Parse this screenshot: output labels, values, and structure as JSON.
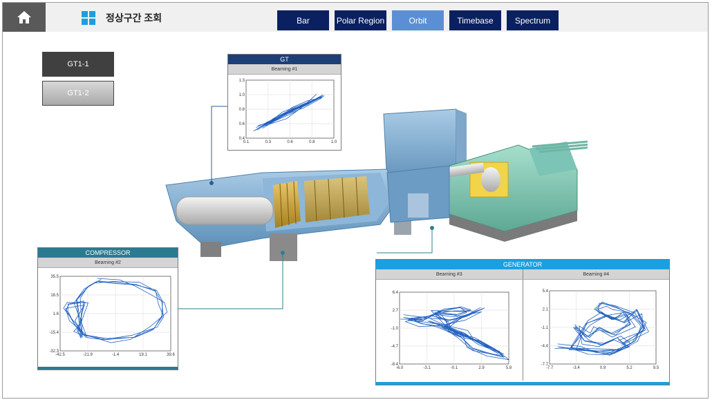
{
  "header": {
    "title": "정상구간 조회",
    "tabs": [
      {
        "label": "Bar",
        "active": false
      },
      {
        "label": "Polar Region",
        "active": false
      },
      {
        "label": "Orbit",
        "active": true
      },
      {
        "label": "Timebase",
        "active": false
      },
      {
        "label": "Spectrum",
        "active": false
      }
    ]
  },
  "units": [
    {
      "label": "GT1-1",
      "selected": false
    },
    {
      "label": "GT1-2",
      "selected": true
    }
  ],
  "panels": {
    "gt": {
      "title": "GT",
      "subtitle": "Bearning #1"
    },
    "compressor": {
      "title": "COMPRESSOR",
      "subtitle": "Bearning #2"
    },
    "generator": {
      "title": "GENERATOR",
      "sub1": "Bearning #3",
      "sub2": "Bearning #4"
    }
  },
  "chart_data": [
    {
      "type": "line",
      "name": "Bearning #1",
      "xlim": [
        0.1,
        1.0
      ],
      "ylim": [
        0.4,
        1.3
      ],
      "xticks": [
        "0.1",
        "0.3",
        "0.6",
        "0.8",
        "1.0"
      ],
      "yticks": [
        "1.3",
        "1.0",
        "0.8",
        "0.6",
        "0.4"
      ],
      "trace": [
        [
          0.2,
          0.53
        ],
        [
          0.42,
          0.72
        ],
        [
          0.62,
          0.86
        ],
        [
          0.78,
          0.98
        ],
        [
          0.88,
          1.06
        ],
        [
          0.72,
          0.93
        ],
        [
          0.5,
          0.78
        ],
        [
          0.32,
          0.62
        ],
        [
          0.48,
          0.74
        ],
        [
          0.68,
          0.9
        ],
        [
          0.86,
          1.04
        ],
        [
          0.75,
          0.96
        ],
        [
          0.58,
          0.85
        ],
        [
          0.4,
          0.7
        ],
        [
          0.26,
          0.58
        ]
      ]
    },
    {
      "type": "line",
      "name": "Bearning #2",
      "xlim": [
        -42.5,
        39.6
      ],
      "ylim": [
        -32.3,
        35.5
      ],
      "xticks": [
        "-42.5",
        "-21.9",
        "-1.4",
        "19.1",
        "39.6"
      ],
      "yticks": [
        "35.5",
        "18.5",
        "1.6",
        "-15.4",
        "-32.3"
      ],
      "trace": [
        [
          -15,
          31
        ],
        [
          -2,
          30
        ],
        [
          14,
          28
        ],
        [
          28,
          22
        ],
        [
          33,
          12
        ],
        [
          34,
          0
        ],
        [
          27,
          -12
        ],
        [
          12,
          -20
        ],
        [
          -8,
          -22
        ],
        [
          -25,
          -18
        ],
        [
          -32,
          -8
        ],
        [
          -38,
          5
        ],
        [
          -36,
          10
        ],
        [
          -24,
          12
        ],
        [
          -28,
          -6
        ],
        [
          -30,
          -14
        ],
        [
          -26,
          -20
        ],
        [
          -30,
          14
        ],
        [
          -22,
          26
        ],
        [
          -15,
          31
        ]
      ]
    },
    {
      "type": "line",
      "name": "Bearning #3",
      "xlim": [
        -6.0,
        5.8
      ],
      "ylim": [
        -8.4,
        6.4
      ],
      "xticks": [
        "-6.0",
        "-3.1",
        "-0.1",
        "2.9",
        "5.8"
      ],
      "yticks": [
        "6.4",
        "2.7",
        "-1.0",
        "-4.7",
        "-8.4"
      ],
      "trace": [
        [
          -5.6,
          1.2
        ],
        [
          -3.5,
          0.6
        ],
        [
          -1.5,
          2.5
        ],
        [
          0.5,
          3.2
        ],
        [
          1.6,
          2.6
        ],
        [
          0.2,
          1.8
        ],
        [
          -2.2,
          2.2
        ],
        [
          -0.9,
          0.3
        ],
        [
          -0.4,
          -1.5
        ],
        [
          0.8,
          -2.6
        ],
        [
          2.6,
          -3.6
        ],
        [
          4.4,
          -5.6
        ],
        [
          5.3,
          -7.0
        ],
        [
          3.5,
          -6.2
        ],
        [
          1.8,
          -5.2
        ],
        [
          0.6,
          -2.8
        ],
        [
          -1.8,
          -0.6
        ],
        [
          -3.6,
          -0.1
        ],
        [
          -5.0,
          0.8
        ],
        [
          -2.5,
          1.5
        ],
        [
          -0.6,
          0.7
        ],
        [
          1.2,
          1.5
        ],
        [
          3.0,
          3.0
        ],
        [
          0.6,
          1.0
        ],
        [
          -1.2,
          -0.8
        ],
        [
          0.2,
          -1.9
        ],
        [
          1.6,
          -3.0
        ],
        [
          3.3,
          -4.7
        ],
        [
          4.9,
          -6.0
        ],
        [
          2.5,
          -4.0
        ],
        [
          1.0,
          -2.0
        ],
        [
          -2.8,
          0.5
        ]
      ]
    },
    {
      "type": "line",
      "name": "Bearning #4",
      "xlim": [
        -7.7,
        9.5
      ],
      "ylim": [
        -7.7,
        5.4
      ],
      "xticks": [
        "-7.7",
        "-3.4",
        "0.9",
        "5.2",
        "9.5"
      ],
      "yticks": [
        "5.4",
        "2.1",
        "-1.1",
        "-4.4",
        "-7.7"
      ],
      "trace": [
        [
          -6.4,
          -4.6
        ],
        [
          -3.4,
          -5.0
        ],
        [
          0.0,
          -5.4
        ],
        [
          3.5,
          -5.2
        ],
        [
          6.1,
          -3.6
        ],
        [
          7.3,
          -0.8
        ],
        [
          5.6,
          1.2
        ],
        [
          3.0,
          2.4
        ],
        [
          0.8,
          3.2
        ],
        [
          -0.2,
          2.0
        ],
        [
          2.3,
          0.4
        ],
        [
          4.6,
          1.3
        ],
        [
          5.4,
          -0.6
        ],
        [
          2.5,
          -2.4
        ],
        [
          0.2,
          -1.2
        ],
        [
          -1.4,
          -2.8
        ],
        [
          -3.6,
          -1.0
        ],
        [
          -2.0,
          -3.6
        ],
        [
          0.8,
          -4.2
        ],
        [
          3.2,
          -3.0
        ],
        [
          5.0,
          -4.6
        ],
        [
          2.0,
          -6.0
        ],
        [
          -1.2,
          -5.4
        ],
        [
          -4.2,
          -4.9
        ],
        [
          -1.6,
          -0.4
        ],
        [
          1.4,
          1.0
        ],
        [
          4.2,
          -0.2
        ],
        [
          6.5,
          1.9
        ],
        [
          7.8,
          -1.6
        ],
        [
          4.0,
          -4.0
        ]
      ]
    }
  ]
}
